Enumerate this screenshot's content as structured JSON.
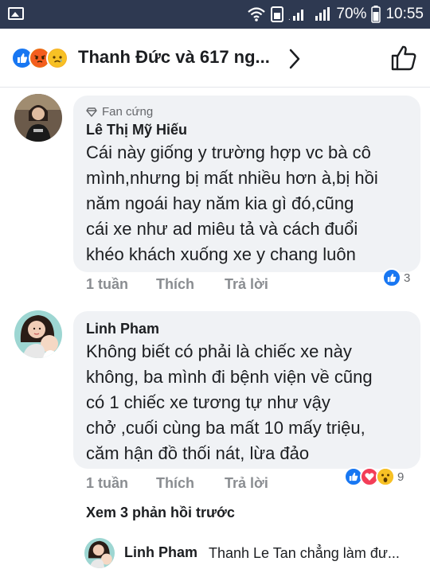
{
  "status_bar": {
    "battery": "70%",
    "time": "10:55",
    "icons": [
      "image-icon",
      "wifi-icon",
      "sim-icon",
      "signal-icon",
      "signal-icon"
    ]
  },
  "header": {
    "title": "Thanh Đức và 617 ng...",
    "reactions": [
      "like-icon",
      "angry-icon",
      "sad-icon"
    ]
  },
  "comments": [
    {
      "badge": "Fan cứng",
      "author": "Lê Thị Mỹ Hiếu",
      "lines": [
        "Cái này giống y trường hợp vc bà cô",
        "mình,nhưng bị mất nhiều hơn à,bị hồi",
        "năm ngoái hay năm kia gì đó,cũng",
        "cái xe như ad miêu tả và cách đuổi",
        "khéo khách xuống xe y chang luôn"
      ],
      "time": "1 tuần",
      "like_label": "Thích",
      "reply_label": "Trả lời",
      "reaction_count": "3"
    },
    {
      "author": "Linh Pham",
      "lines": [
        "Không biết có phải là chiếc xe này",
        "không, ba mình đi bệnh viện về cũng",
        "có 1 chiếc xe tương tự như vậy",
        "chở ,cuối cùng ba mất 10 mấy triệu,",
        "căm hận đồ thối nát, lừa đảo"
      ],
      "time": "1 tuần",
      "like_label": "Thích",
      "reply_label": "Trả lời",
      "reaction_count": "9"
    }
  ],
  "view_more": "Xem 3 phản hồi trước",
  "reply_preview": {
    "author": "Linh Pham",
    "mention": "Thanh Le Tan",
    "text": " chẳng làm đư..."
  }
}
